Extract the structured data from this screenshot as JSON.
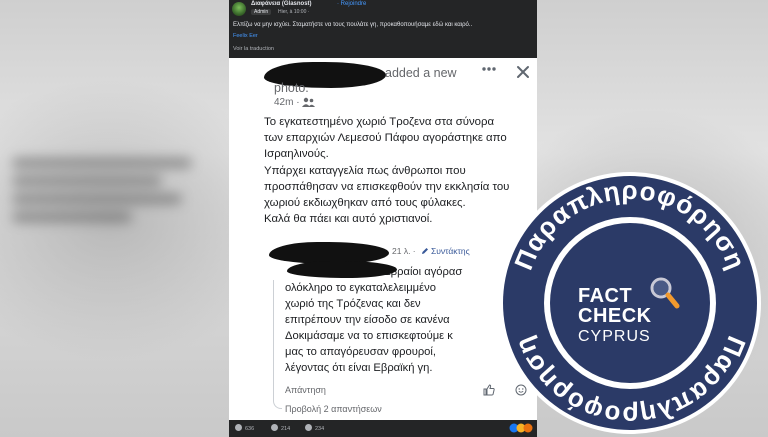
{
  "facebook": {
    "group_name": "Διαφάνεια (Glasnost)",
    "rejoin_label": "· Rejoindre",
    "admin_badge": "Admin",
    "post_time": "Hier, à 10:00 · ",
    "caption": "Ελπίζω να μην ισχύει. Σταματήστε να τους πουλάτε γη, προκαθοπουήσαμε εδώ και καιρό..",
    "feeling": "Feelix Eer",
    "translate_label": "Voir la traduction",
    "footer": {
      "likes": "636",
      "comments": "214",
      "shares": "234"
    }
  },
  "screenshot": {
    "added_photo_line1": "added a new",
    "added_photo_line2": "photo.",
    "post_age": "42m ·",
    "post_text": [
      "Το εγκατεστημένο χωριό Τροζενα στα σύνορα",
      "των επαρχιών Λεμεσού Πάφου αγοράστηκε απο",
      "Ισραηλινούς.",
      "Υπάρχει καταγγελία πως άνθρωποι που",
      "προσπάθησαν να επισκεφθούν την εκκλησία  του",
      "χωριού εκδιωχθηκαν από τους φύλακες.",
      "Καλά θα πάει και αυτό χριστιανοί."
    ],
    "comment": {
      "age": "21 λ. ·",
      "author_label": "Συντάκτης",
      "text": [
        "                           Οι Εβραίοι αγόρασ",
        "ολόκληρο το εγκαταλελειμμένο",
        "χωριό της Τρόζενας και δεν",
        "επιτρέπουν την είσοδο σε κανένα",
        "Δοκιμάσαμε να το επισκεφτούμε κ",
        "μας το απαγόρευσαν φρουροί,",
        "λέγοντας ότι είναι Εβραϊκή γη."
      ],
      "reply_label": "Απάντηση",
      "view_replies": "Προβολή 2 απαντήσεων"
    }
  },
  "badge": {
    "ring_text_top": "Παραπληροφόρηση",
    "ring_text_bottom": "Παραπληροφόρηση",
    "fact": "FACT",
    "check": "CHECK",
    "cyprus": "CYPRUS",
    "colors": {
      "navy": "#2b3a67",
      "orange": "#f29a2e",
      "white": "#ffffff"
    }
  }
}
